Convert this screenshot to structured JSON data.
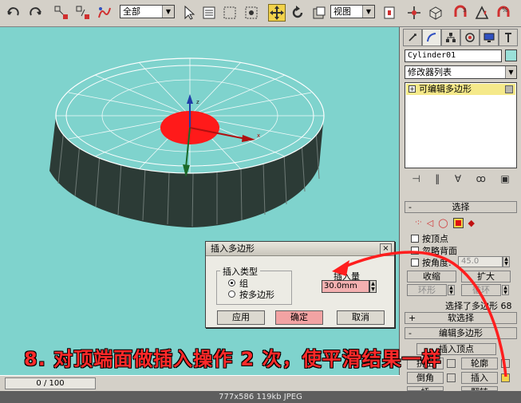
{
  "toolbar": {
    "selection_filter": "全部",
    "coordinate_system": "视图"
  },
  "command_panel": {
    "tabs": [
      "create-tab",
      "modify-tab",
      "hierarchy-tab",
      "motion-tab",
      "display-tab",
      "utilities-tab"
    ],
    "object_name": "Cylinder01",
    "object_color": "#9ae0d8",
    "modifier_list": "修改器列表",
    "stack_item": "可编辑多边形",
    "selection_rollout": {
      "title": "选择",
      "by_vertex": "按顶点",
      "ignore_backfacing": "忽略背面",
      "by_angle": "按角度:",
      "angle_value": "45.0",
      "shrink": "收缩",
      "grow": "扩大",
      "ring": "环形",
      "loop": "循环",
      "selected_status": "选择了多边形 68"
    },
    "soft_selection_rollout": {
      "title": "软选择"
    },
    "edit_polygons_rollout": {
      "title": "编辑多边形",
      "insert_vertex": "插入顶点",
      "extrude": "挤出",
      "outline": "轮廓",
      "bevel": "倒角",
      "inset": "插入",
      "bridge_partial": "桥",
      "flip_partial": "翻转"
    }
  },
  "dialog": {
    "title": "插入多边形",
    "close": "×",
    "inset_type_label": "插入类型",
    "option_group": "组",
    "option_by_polygon": "按多边形",
    "amount_label": "插入量",
    "amount_value": "30.0mm",
    "apply": "应用",
    "ok": "确定",
    "cancel": "取消"
  },
  "timebar": {
    "frame": "0 / 100"
  },
  "caption": "8. 对顶端面做插入操作 2 次，使平滑结果一样",
  "statusbar": "777x586  119kb  JPEG",
  "colors": {
    "viewport_bg": "#7fd3cd",
    "selected_face": "#ff1a1a",
    "caption": "#ff2a2a",
    "highlight_tool": "#f2d24a"
  }
}
